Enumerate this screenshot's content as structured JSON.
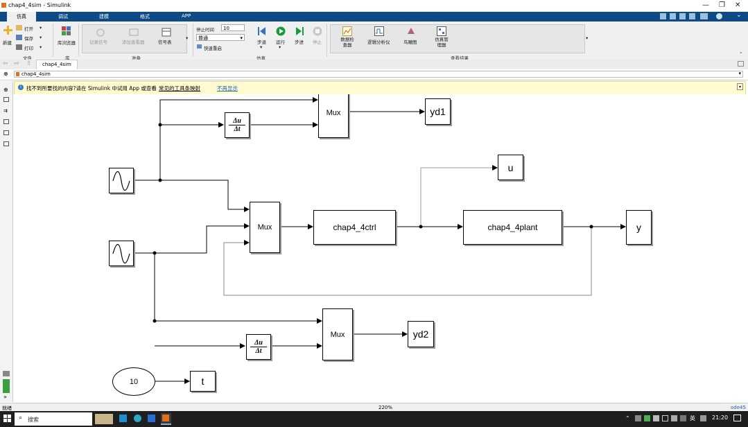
{
  "window": {
    "title": "chap4_4sim - Simulink"
  },
  "tabs": [
    "仿真",
    "调试",
    "建模",
    "格式",
    "APP"
  ],
  "ribbon": {
    "new_label": "新建",
    "open_label": "打开",
    "save_label": "保存",
    "print_label": "打印",
    "file_group": "文件",
    "lib_browser": "库浏览器",
    "lib_group": "库",
    "record_signal": "记录信号",
    "add_viewer": "添加查看器",
    "signal_table": "信号表",
    "prepare_group": "准备",
    "stop_time_label": "停止时间",
    "stop_time_value": "10",
    "mode_value": "普通",
    "fast_restart": "快速重启",
    "step_back": "步退",
    "run": "运行",
    "step_forward": "步进",
    "stop": "停止",
    "sim_group": "仿真",
    "data_inspector": "数据检查器",
    "logic_analyzer": "逻辑分析仪",
    "bird_eye": "鸟瞰图",
    "sim_manager": "仿真管理器",
    "review_group": "查看结果"
  },
  "breadcrumb": {
    "tab": "chap4_4sim",
    "path": "chap4_4sim"
  },
  "banner": {
    "text": "找不到所要找的内容?请在 Simulink 中试用 App 或查看",
    "link1": "常见的工具条映射",
    "link2": "不再显示"
  },
  "diagram": {
    "mux1": "Mux",
    "mux2": "Mux",
    "mux3": "Mux",
    "deriv_num": "Δu",
    "deriv_den": "Δt",
    "yd1": "yd1",
    "u": "u",
    "ctrl": "chap4_4ctrl",
    "plant": "chap4_4plant",
    "y": "y",
    "yd2": "yd2",
    "const": "10",
    "t": "t"
  },
  "status": {
    "left": "就绪",
    "zoom": "220%",
    "solver": "ode45"
  },
  "taskbar": {
    "search": "搜索",
    "lang": "英",
    "time": "21:20"
  }
}
